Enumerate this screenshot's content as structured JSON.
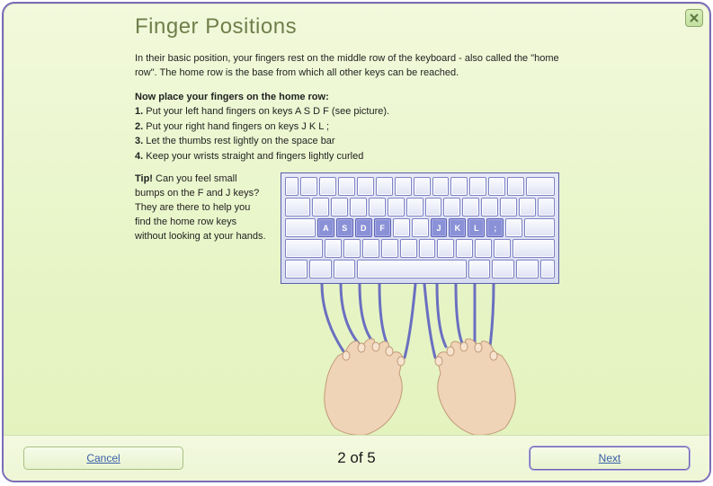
{
  "title": "Finger Positions",
  "intro": "In their basic position, your fingers rest on the middle row of the keyboard - also called the \"home row\". The home row is the base from which all other keys can be reached.",
  "instructions_lead": "Now place your fingers on the home row:",
  "steps": [
    {
      "n": "1.",
      "text": "Put your left hand fingers on keys A S D F (see picture)."
    },
    {
      "n": "2.",
      "text": "Put your right hand fingers on keys J K L ;"
    },
    {
      "n": "3.",
      "text": "Let the thumbs rest lightly on the space bar"
    },
    {
      "n": "4.",
      "text": "Keep your wrists straight and fingers lightly curled"
    }
  ],
  "tip_label": "Tip!",
  "tip_text": "Can you feel small bumps on the F and J keys? They are there to help you find the home row keys without looking at your hands.",
  "home_keys": {
    "A": "A",
    "S": "S",
    "D": "D",
    "F": "F",
    "J": "J",
    "K": "K",
    "L": "L",
    "semi": ";"
  },
  "footer": {
    "cancel": "Cancel",
    "next": "Next",
    "progress": "2 of 5"
  }
}
